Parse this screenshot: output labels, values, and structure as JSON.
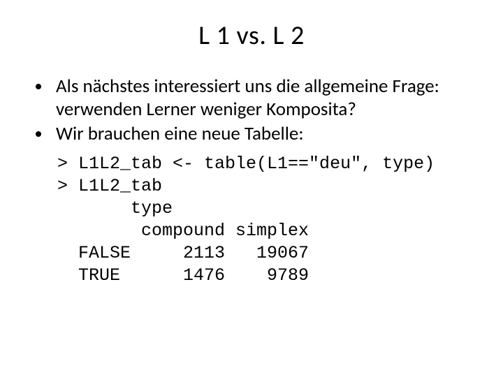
{
  "title": "L 1 vs. L 2",
  "bullets": [
    "Als nächstes interessiert uns die allgemeine Frage: verwenden Lerner weniger Komposita?",
    "Wir brauchen eine neue Tabelle:"
  ],
  "code": {
    "line1": "> L1L2_tab <- table(L1==\"deu\", type)",
    "line2": "> L1L2_tab",
    "line3": "       type",
    "line4": "        compound simplex",
    "line5": "  FALSE     2113   19067",
    "line6": "  TRUE      1476    9789"
  },
  "chart_data": {
    "type": "table",
    "title": "L1L2_tab",
    "row_labels": [
      "FALSE",
      "TRUE"
    ],
    "col_labels": [
      "compound",
      "simplex"
    ],
    "values": [
      [
        2113,
        19067
      ],
      [
        1476,
        9789
      ]
    ]
  }
}
